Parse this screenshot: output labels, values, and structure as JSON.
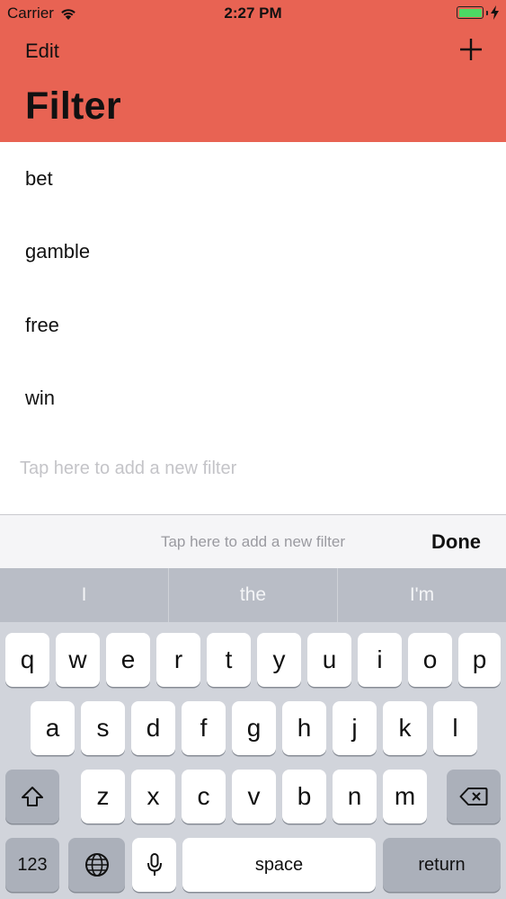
{
  "status_bar": {
    "carrier": "Carrier",
    "time": "2:27 PM"
  },
  "nav": {
    "edit_label": "Edit",
    "title": "Filter"
  },
  "filters": [
    "bet",
    "gamble",
    "free",
    "win"
  ],
  "new_filter_placeholder": "Tap here to add a new filter",
  "accessory_bar": {
    "placeholder": "Tap here to add a new filter",
    "done_label": "Done"
  },
  "keyboard": {
    "suggestions": [
      "I",
      "the",
      "I'm"
    ],
    "row1": [
      "q",
      "w",
      "e",
      "r",
      "t",
      "y",
      "u",
      "i",
      "o",
      "p"
    ],
    "row2": [
      "a",
      "s",
      "d",
      "f",
      "g",
      "h",
      "j",
      "k",
      "l"
    ],
    "row3": [
      "z",
      "x",
      "c",
      "v",
      "b",
      "n",
      "m"
    ],
    "numbers_label": "123",
    "space_label": "space",
    "return_label": "return"
  },
  "colors": {
    "header": "#E86353",
    "battery": "#4CD964",
    "keyboard_bg": "#D1D4DB"
  },
  "icons": [
    "wifi-icon",
    "battery-icon",
    "charging-icon",
    "plus-icon",
    "shift-icon",
    "backspace-icon",
    "globe-icon",
    "microphone-icon"
  ]
}
